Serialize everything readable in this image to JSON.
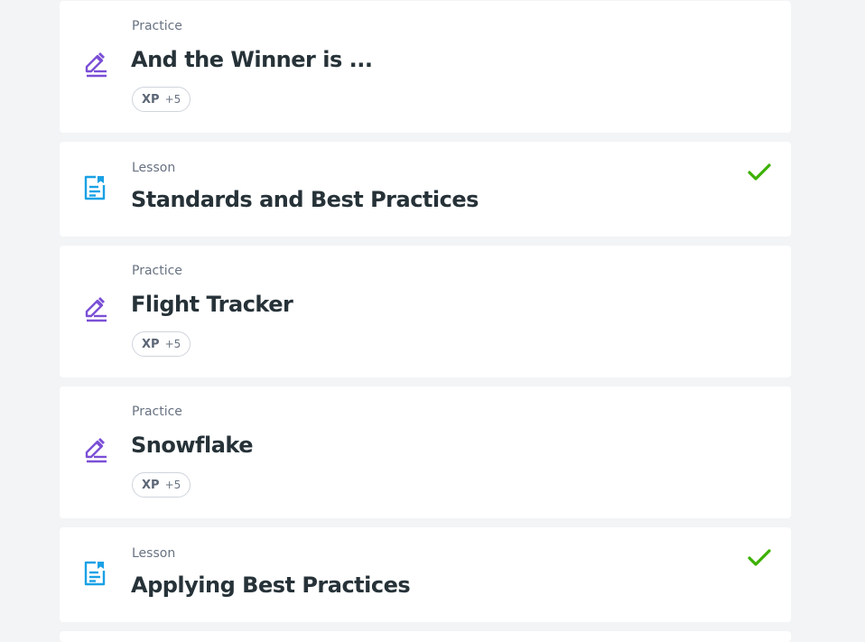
{
  "colors": {
    "practice_icon": "#7b4fd6",
    "lesson_icon": "#1aa1e5",
    "check": "#3cb000",
    "title": "#263238",
    "muted": "#687282",
    "background": "#f2f4f6"
  },
  "items": [
    {
      "kind": "Practice",
      "title": "And the Winner is ...",
      "xp_label": "XP",
      "xp_value": "+5",
      "icon": "pencil-icon",
      "completed": false
    },
    {
      "kind": "Lesson",
      "title": "Standards and Best Practices",
      "icon": "document-icon",
      "completed": true
    },
    {
      "kind": "Practice",
      "title": "Flight Tracker",
      "xp_label": "XP",
      "xp_value": "+5",
      "icon": "pencil-icon",
      "completed": false
    },
    {
      "kind": "Practice",
      "title": "Snowflake",
      "xp_label": "XP",
      "xp_value": "+5",
      "icon": "pencil-icon",
      "completed": false
    },
    {
      "kind": "Lesson",
      "title": "Applying Best Practices",
      "icon": "document-icon",
      "completed": true
    }
  ]
}
